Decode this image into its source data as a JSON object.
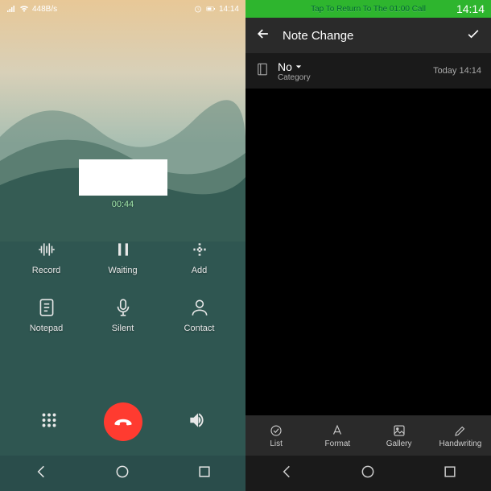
{
  "left": {
    "statusbar": {
      "net_speed": "448B/s",
      "time": "14:14"
    },
    "caller_name": "",
    "timer": "00:44",
    "buttons": {
      "record": "Record",
      "waiting": "Waiting",
      "add": "Add",
      "notepad": "Notepad",
      "silent": "Silent",
      "contact": "Contact"
    }
  },
  "right": {
    "callbar": {
      "text": "Tap To Return To The 01:00 Call",
      "time": "14:14"
    },
    "titlebar": {
      "title": "Note Change"
    },
    "note": {
      "title": "No",
      "category": "Category",
      "date": "Today 14:14"
    },
    "toolbar": {
      "list": "List",
      "format": "Format",
      "gallery": "Gallery",
      "handwriting": "Handwriting"
    }
  }
}
